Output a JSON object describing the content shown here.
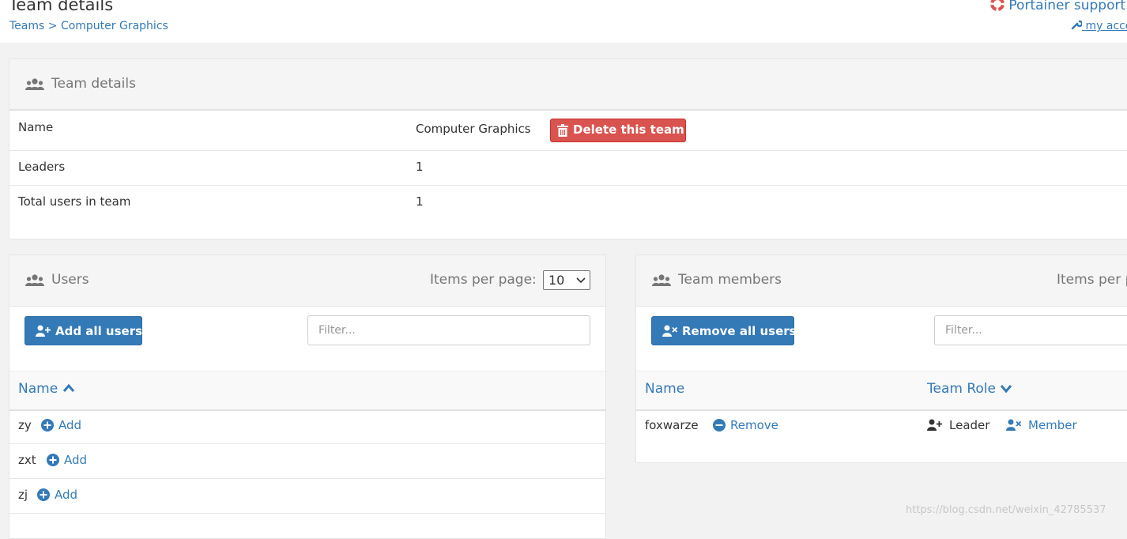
{
  "header": {
    "title": "Team details",
    "breadcrumb": {
      "root": "Teams",
      "separator": ">",
      "current": "Computer Graphics"
    },
    "support_link": "Portainer support",
    "account_link": "my account"
  },
  "details": {
    "title": "Team details",
    "rows": [
      {
        "label": "Name",
        "value": "Computer Graphics"
      },
      {
        "label": "Leaders",
        "value": "1"
      },
      {
        "label": "Total users in team",
        "value": "1"
      }
    ],
    "delete_button": "Delete this team"
  },
  "users": {
    "title": "Users",
    "items_per_page_label": "Items per page:",
    "items_per_page_value": "10",
    "add_all_button": "Add all users",
    "filter_placeholder": "Filter...",
    "col_name": "Name",
    "rows": [
      {
        "name": "zy",
        "action": "Add"
      },
      {
        "name": "zxt",
        "action": "Add"
      },
      {
        "name": "zj",
        "action": "Add"
      }
    ]
  },
  "members": {
    "title": "Team members",
    "items_per_page_label": "Items per page:",
    "remove_all_button": "Remove all users",
    "filter_placeholder": "Filter...",
    "col_name": "Name",
    "col_role": "Team Role",
    "rows": [
      {
        "name": "foxwarze",
        "action": "Remove",
        "role_leader": "Leader",
        "role_member": "Member"
      }
    ]
  },
  "watermark": "https://blog.csdn.net/weixin_42785537",
  "colors": {
    "link": "#337ab7",
    "danger": "#d9534f",
    "primary": "#337ab7"
  }
}
